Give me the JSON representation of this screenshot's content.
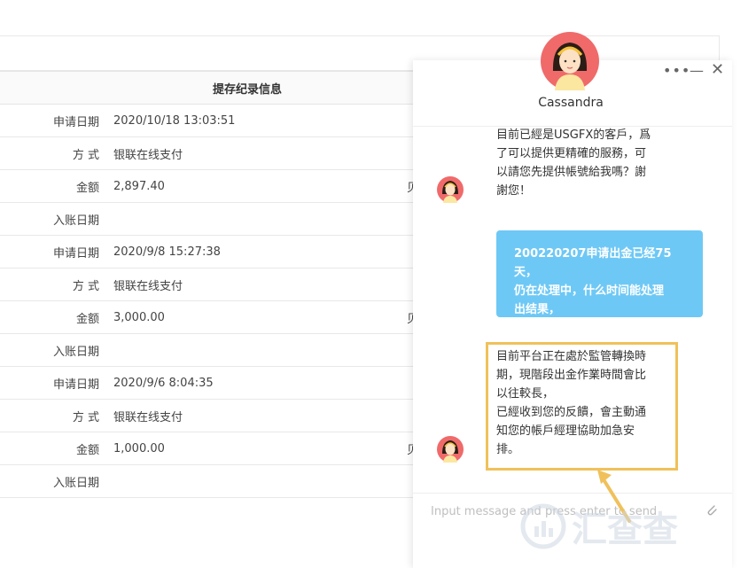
{
  "table": {
    "title": "提存纪录信息",
    "rows": [
      {
        "label": "申请日期",
        "value": "2020/10/18 13:03:51",
        "tail": ""
      },
      {
        "label": "方 式",
        "value": "银联在线支付",
        "tail": ""
      },
      {
        "label": "金额",
        "value": "2,897.40",
        "tail": "贝"
      },
      {
        "label": "入账日期",
        "value": "",
        "tail": ""
      },
      {
        "label": "申请日期",
        "value": "2020/9/8 15:27:38",
        "tail": ""
      },
      {
        "label": "方 式",
        "value": "银联在线支付",
        "tail": ""
      },
      {
        "label": "金额",
        "value": "3,000.00",
        "tail": "贝"
      },
      {
        "label": "入账日期",
        "value": "",
        "tail": ""
      },
      {
        "label": "申请日期",
        "value": "2020/9/6 8:04:35",
        "tail": ""
      },
      {
        "label": "方 式",
        "value": "银联在线支付",
        "tail": ""
      },
      {
        "label": "金额",
        "value": "1,000.00",
        "tail": "贝"
      },
      {
        "label": "入账日期",
        "value": "",
        "tail": ""
      }
    ]
  },
  "chat": {
    "agent_name": "Cassandra",
    "header_buttons": {
      "more": "•••",
      "minimize": "—",
      "close": "✕"
    },
    "messages": [
      {
        "from": "agent",
        "lines": [
          "目前已經是USGFX的客戶，爲",
          "了可以提供更精確的服務，可",
          "以請您先提供帳號給我嗎？謝",
          "謝您！"
        ]
      },
      {
        "from": "user",
        "lines": [
          "200220207申请出金已经75天，",
          "仍在处理中，什么时间能处理",
          "出结果，"
        ]
      },
      {
        "from": "agent",
        "lines": [
          "目前平台正在處於監管轉換時",
          "期，現階段出金作業時間會比",
          "以往較長，",
          "已經收到您的反饋，會主動通",
          "知您的帳戶經理協助加急安",
          "排。"
        ]
      }
    ],
    "input_placeholder": "Input message and press enter to send"
  },
  "colors": {
    "user_bubble": "#6ec8f5",
    "highlight": "#f0c15a",
    "avatar_bg": "#f06a6a"
  },
  "watermark": {
    "text": "汇查查"
  }
}
